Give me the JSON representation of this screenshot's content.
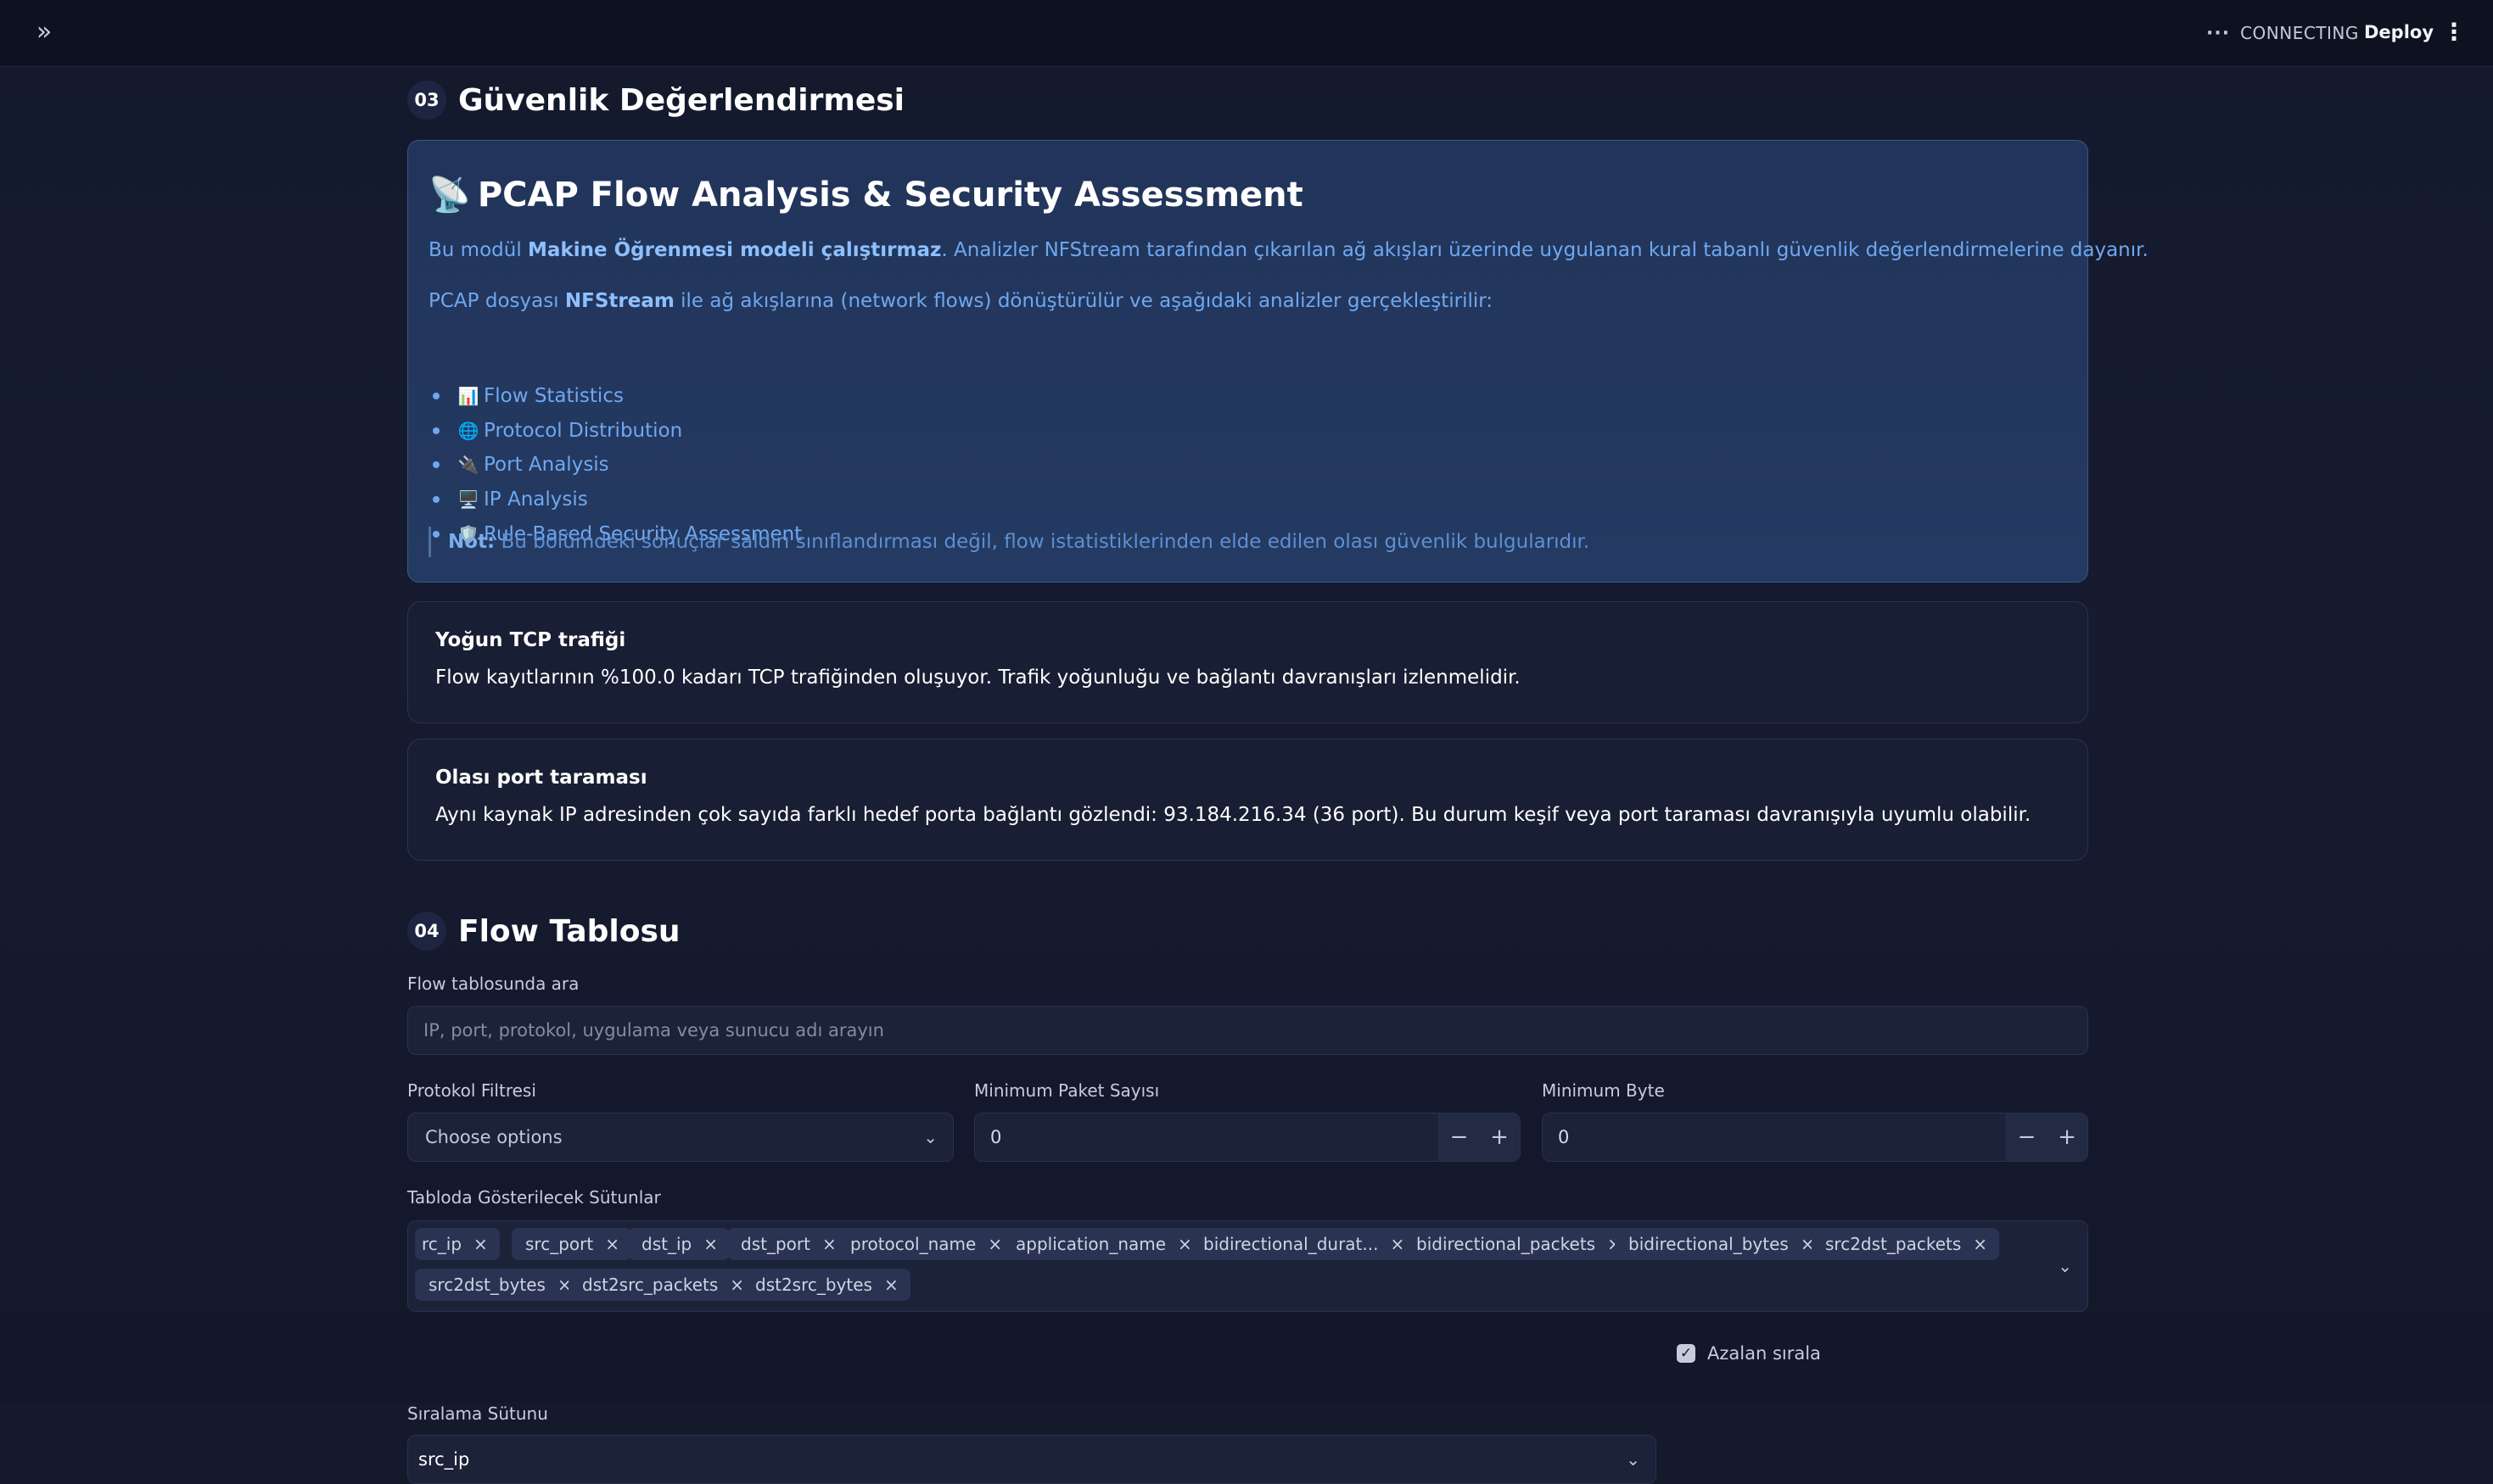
{
  "topbar": {
    "status": "CONNECTING",
    "deploy_label": "Deploy",
    "expand_icon": "double-chevron-right-icon",
    "menu_icon": "kebab-menu-icon"
  },
  "section3": {
    "number": "03",
    "title": "Güvenlik Değerlendirmesi",
    "info": {
      "title_icon": "📡",
      "title": "PCAP Flow Analysis & Security Assessment",
      "p1_pre": "Bu modül ",
      "p1_bold": "Makine Öğrenmesi modeli çalıştırmaz",
      "p1_post": ". Analizler NFStream tarafından çıkarılan ağ akışları üzerinde uygulanan kural tabanlı güvenlik değerlendirmelerine dayanır.",
      "p2_pre": "PCAP dosyası ",
      "p2_bold": "NFStream",
      "p2_post": " ile ağ akışlarına (network flows) dönüştürülür ve aşağıdaki analizler gerçekleştirilir:",
      "bullets": [
        {
          "icon": "📊",
          "label": "Flow Statistics"
        },
        {
          "icon": "🌐",
          "label": "Protocol Distribution"
        },
        {
          "icon": "🔌",
          "label": "Port Analysis"
        },
        {
          "icon": "🖥️",
          "label": "IP Analysis"
        },
        {
          "icon": "🛡️",
          "label": "Rule-Based Security Assessment"
        }
      ],
      "note_bold": "Not:",
      "note_text": " Bu bölümdeki sonuçlar saldırı sınıflandırması değil, flow istatistiklerinden elde edilen olası güvenlik bulgularıdır."
    },
    "alerts": [
      {
        "title": "Yoğun TCP trafiği",
        "text": "Flow kayıtlarının %100.0 kadarı TCP trafiğinden oluşuyor. Trafik yoğunluğu ve bağlantı davranışları izlenmelidir."
      },
      {
        "title": "Olası port taraması",
        "text": "Aynı kaynak IP adresinden çok sayıda farklı hedef porta bağlantı gözlendi: 93.184.216.34 (36 port). Bu durum keşif veya port taraması davranışıyla uyumlu olabilir."
      }
    ]
  },
  "section4": {
    "number": "04",
    "title": "Flow Tablosu",
    "search": {
      "label": "Flow tablosunda ara",
      "placeholder": "IP, port, protokol, uygulama veya sunucu adı arayın"
    },
    "protocol_filter": {
      "label": "Protokol Filtresi",
      "placeholder": "Choose options"
    },
    "min_packets": {
      "label": "Minimum Paket Sayısı",
      "value": "0"
    },
    "min_bytes": {
      "label": "Minimum Byte",
      "value": "0"
    },
    "columns": {
      "label": "Tabloda Gösterilecek Sütunlar",
      "chips": [
        "rc_ip",
        "src_port",
        "dst_ip",
        "dst_port",
        "protocol_name",
        "application_name",
        "bidirectional_durat...",
        "bidirectional_packets",
        "bidirectional_bytes",
        "src2dst_packets",
        "src2dst_bytes",
        "dst2src_packets",
        "dst2src_bytes"
      ]
    },
    "sort": {
      "label": "Sıralama Sütunu",
      "value": "src_ip"
    },
    "descending": {
      "label": "Azalan sırala",
      "checked": true
    }
  }
}
